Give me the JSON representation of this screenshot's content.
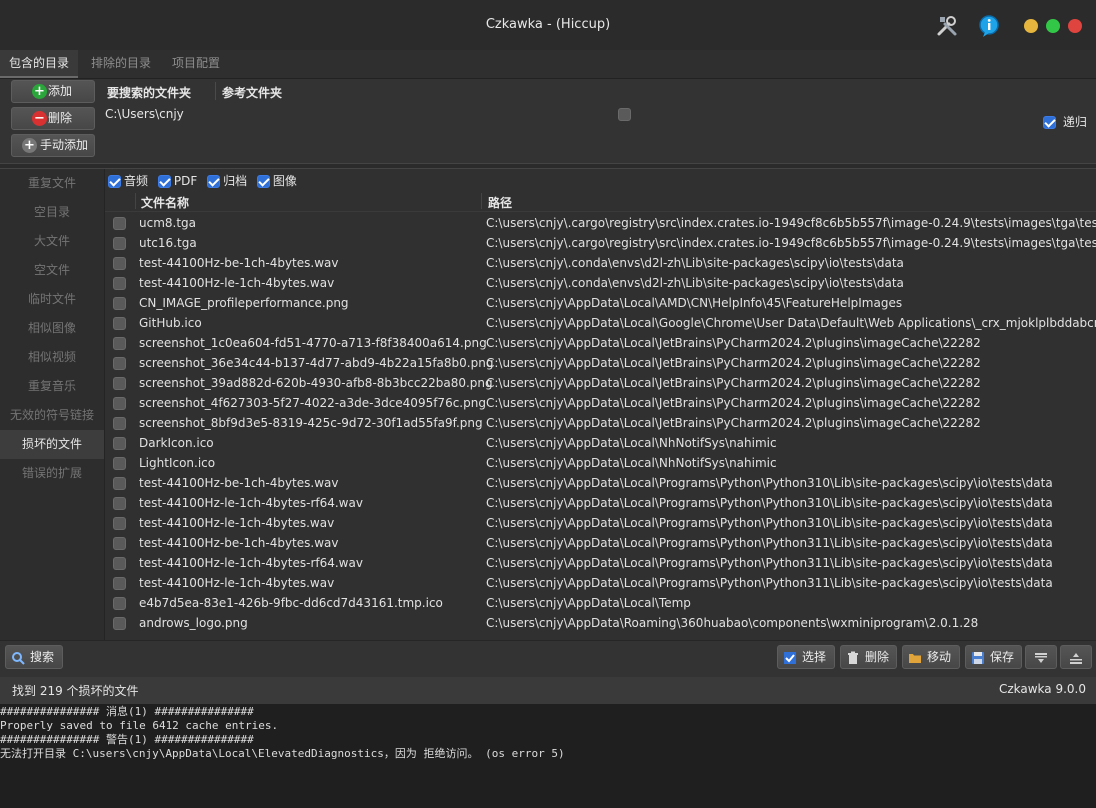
{
  "window": {
    "title": "Czkawka - (Hiccup)"
  },
  "colors": {
    "accent": "#2f6fd8",
    "close": "#e0443e",
    "minimize": "#e5b53d",
    "maximize": "#33c748"
  },
  "tabs": [
    {
      "label": "包含的目录",
      "active": true
    },
    {
      "label": "排除的目录",
      "active": false
    },
    {
      "label": "项目配置",
      "active": false
    }
  ],
  "included": {
    "add_label": "添加",
    "remove_label": "删除",
    "manual_add_label": "手动添加",
    "col_search": "要搜索的文件夹",
    "col_reference": "参考文件夹",
    "folder_path": "C:\\Users\\cnjy",
    "recursive_label": "递归"
  },
  "sidebar": [
    {
      "label": "重复文件"
    },
    {
      "label": "空目录"
    },
    {
      "label": "大文件"
    },
    {
      "label": "空文件"
    },
    {
      "label": "临时文件"
    },
    {
      "label": "相似图像"
    },
    {
      "label": "相似视频"
    },
    {
      "label": "重复音乐"
    },
    {
      "label": "无效的符号链接"
    },
    {
      "label": "损坏的文件",
      "active": true
    },
    {
      "label": "错误的扩展"
    }
  ],
  "filters": [
    {
      "label": "音频",
      "checked": true
    },
    {
      "label": "PDF",
      "checked": true
    },
    {
      "label": "归档",
      "checked": true
    },
    {
      "label": "图像",
      "checked": true
    }
  ],
  "table": {
    "col_name": "文件名称",
    "col_path": "路径",
    "rows": [
      {
        "name": "ucm8.tga",
        "path": "C:\\users\\cnjy\\.cargo\\registry\\src\\index.crates.io-1949cf8c6b5b557f\\image-0.24.9\\tests\\images\\tga\\testsuite"
      },
      {
        "name": "utc16.tga",
        "path": "C:\\users\\cnjy\\.cargo\\registry\\src\\index.crates.io-1949cf8c6b5b557f\\image-0.24.9\\tests\\images\\tga\\testsuite"
      },
      {
        "name": "test-44100Hz-be-1ch-4bytes.wav",
        "path": "C:\\users\\cnjy\\.conda\\envs\\d2l-zh\\Lib\\site-packages\\scipy\\io\\tests\\data"
      },
      {
        "name": "test-44100Hz-le-1ch-4bytes.wav",
        "path": "C:\\users\\cnjy\\.conda\\envs\\d2l-zh\\Lib\\site-packages\\scipy\\io\\tests\\data"
      },
      {
        "name": "CN_IMAGE_profileperformance.png",
        "path": "C:\\users\\cnjy\\AppData\\Local\\AMD\\CN\\HelpInfo\\45\\FeatureHelpImages"
      },
      {
        "name": "GitHub.ico",
        "path": "C:\\users\\cnjy\\AppData\\Local\\Google\\Chrome\\User Data\\Default\\Web Applications\\_crx_mjoklplbddabcmpepnokjaffbmgbkkgg"
      },
      {
        "name": "screenshot_1c0ea604-fd51-4770-a713-f8f38400a614.png",
        "path": "C:\\users\\cnjy\\AppData\\Local\\JetBrains\\PyCharm2024.2\\plugins\\imageCache\\22282"
      },
      {
        "name": "screenshot_36e34c44-b137-4d77-abd9-4b22a15fa8b0.png",
        "path": "C:\\users\\cnjy\\AppData\\Local\\JetBrains\\PyCharm2024.2\\plugins\\imageCache\\22282"
      },
      {
        "name": "screenshot_39ad882d-620b-4930-afb8-8b3bcc22ba80.png",
        "path": "C:\\users\\cnjy\\AppData\\Local\\JetBrains\\PyCharm2024.2\\plugins\\imageCache\\22282"
      },
      {
        "name": "screenshot_4f627303-5f27-4022-a3de-3dce4095f76c.png",
        "path": "C:\\users\\cnjy\\AppData\\Local\\JetBrains\\PyCharm2024.2\\plugins\\imageCache\\22282"
      },
      {
        "name": "screenshot_8bf9d3e5-8319-425c-9d72-30f1ad55fa9f.png",
        "path": "C:\\users\\cnjy\\AppData\\Local\\JetBrains\\PyCharm2024.2\\plugins\\imageCache\\22282"
      },
      {
        "name": "DarkIcon.ico",
        "path": "C:\\users\\cnjy\\AppData\\Local\\NhNotifSys\\nahimic"
      },
      {
        "name": "LightIcon.ico",
        "path": "C:\\users\\cnjy\\AppData\\Local\\NhNotifSys\\nahimic"
      },
      {
        "name": "test-44100Hz-be-1ch-4bytes.wav",
        "path": "C:\\users\\cnjy\\AppData\\Local\\Programs\\Python\\Python310\\Lib\\site-packages\\scipy\\io\\tests\\data"
      },
      {
        "name": "test-44100Hz-le-1ch-4bytes-rf64.wav",
        "path": "C:\\users\\cnjy\\AppData\\Local\\Programs\\Python\\Python310\\Lib\\site-packages\\scipy\\io\\tests\\data"
      },
      {
        "name": "test-44100Hz-le-1ch-4bytes.wav",
        "path": "C:\\users\\cnjy\\AppData\\Local\\Programs\\Python\\Python310\\Lib\\site-packages\\scipy\\io\\tests\\data"
      },
      {
        "name": "test-44100Hz-be-1ch-4bytes.wav",
        "path": "C:\\users\\cnjy\\AppData\\Local\\Programs\\Python\\Python311\\Lib\\site-packages\\scipy\\io\\tests\\data"
      },
      {
        "name": "test-44100Hz-le-1ch-4bytes-rf64.wav",
        "path": "C:\\users\\cnjy\\AppData\\Local\\Programs\\Python\\Python311\\Lib\\site-packages\\scipy\\io\\tests\\data"
      },
      {
        "name": "test-44100Hz-le-1ch-4bytes.wav",
        "path": "C:\\users\\cnjy\\AppData\\Local\\Programs\\Python\\Python311\\Lib\\site-packages\\scipy\\io\\tests\\data"
      },
      {
        "name": "e4b7d5ea-83e1-426b-9fbc-dd6cd7d43161.tmp.ico",
        "path": "C:\\users\\cnjy\\AppData\\Local\\Temp"
      },
      {
        "name": "androws_logo.png",
        "path": "C:\\users\\cnjy\\AppData\\Roaming\\360huabao\\components\\wxminiprogram\\2.0.1.28"
      }
    ]
  },
  "bottom": {
    "search_label": "搜索",
    "select_label": "选择",
    "delete_label": "删除",
    "move_label": "移动",
    "save_label": "保存"
  },
  "status": {
    "text": "找到 219 个损坏的文件",
    "version": "Czkawka 9.0.0"
  },
  "console": [
    "############### 消息(1) ###############",
    "Properly saved to file 6412 cache entries.",
    "############### 警告(1) ###############",
    "无法打开目录 C:\\users\\cnjy\\AppData\\Local\\ElevatedDiagnostics，因为 拒绝访问。 (os error 5)"
  ]
}
